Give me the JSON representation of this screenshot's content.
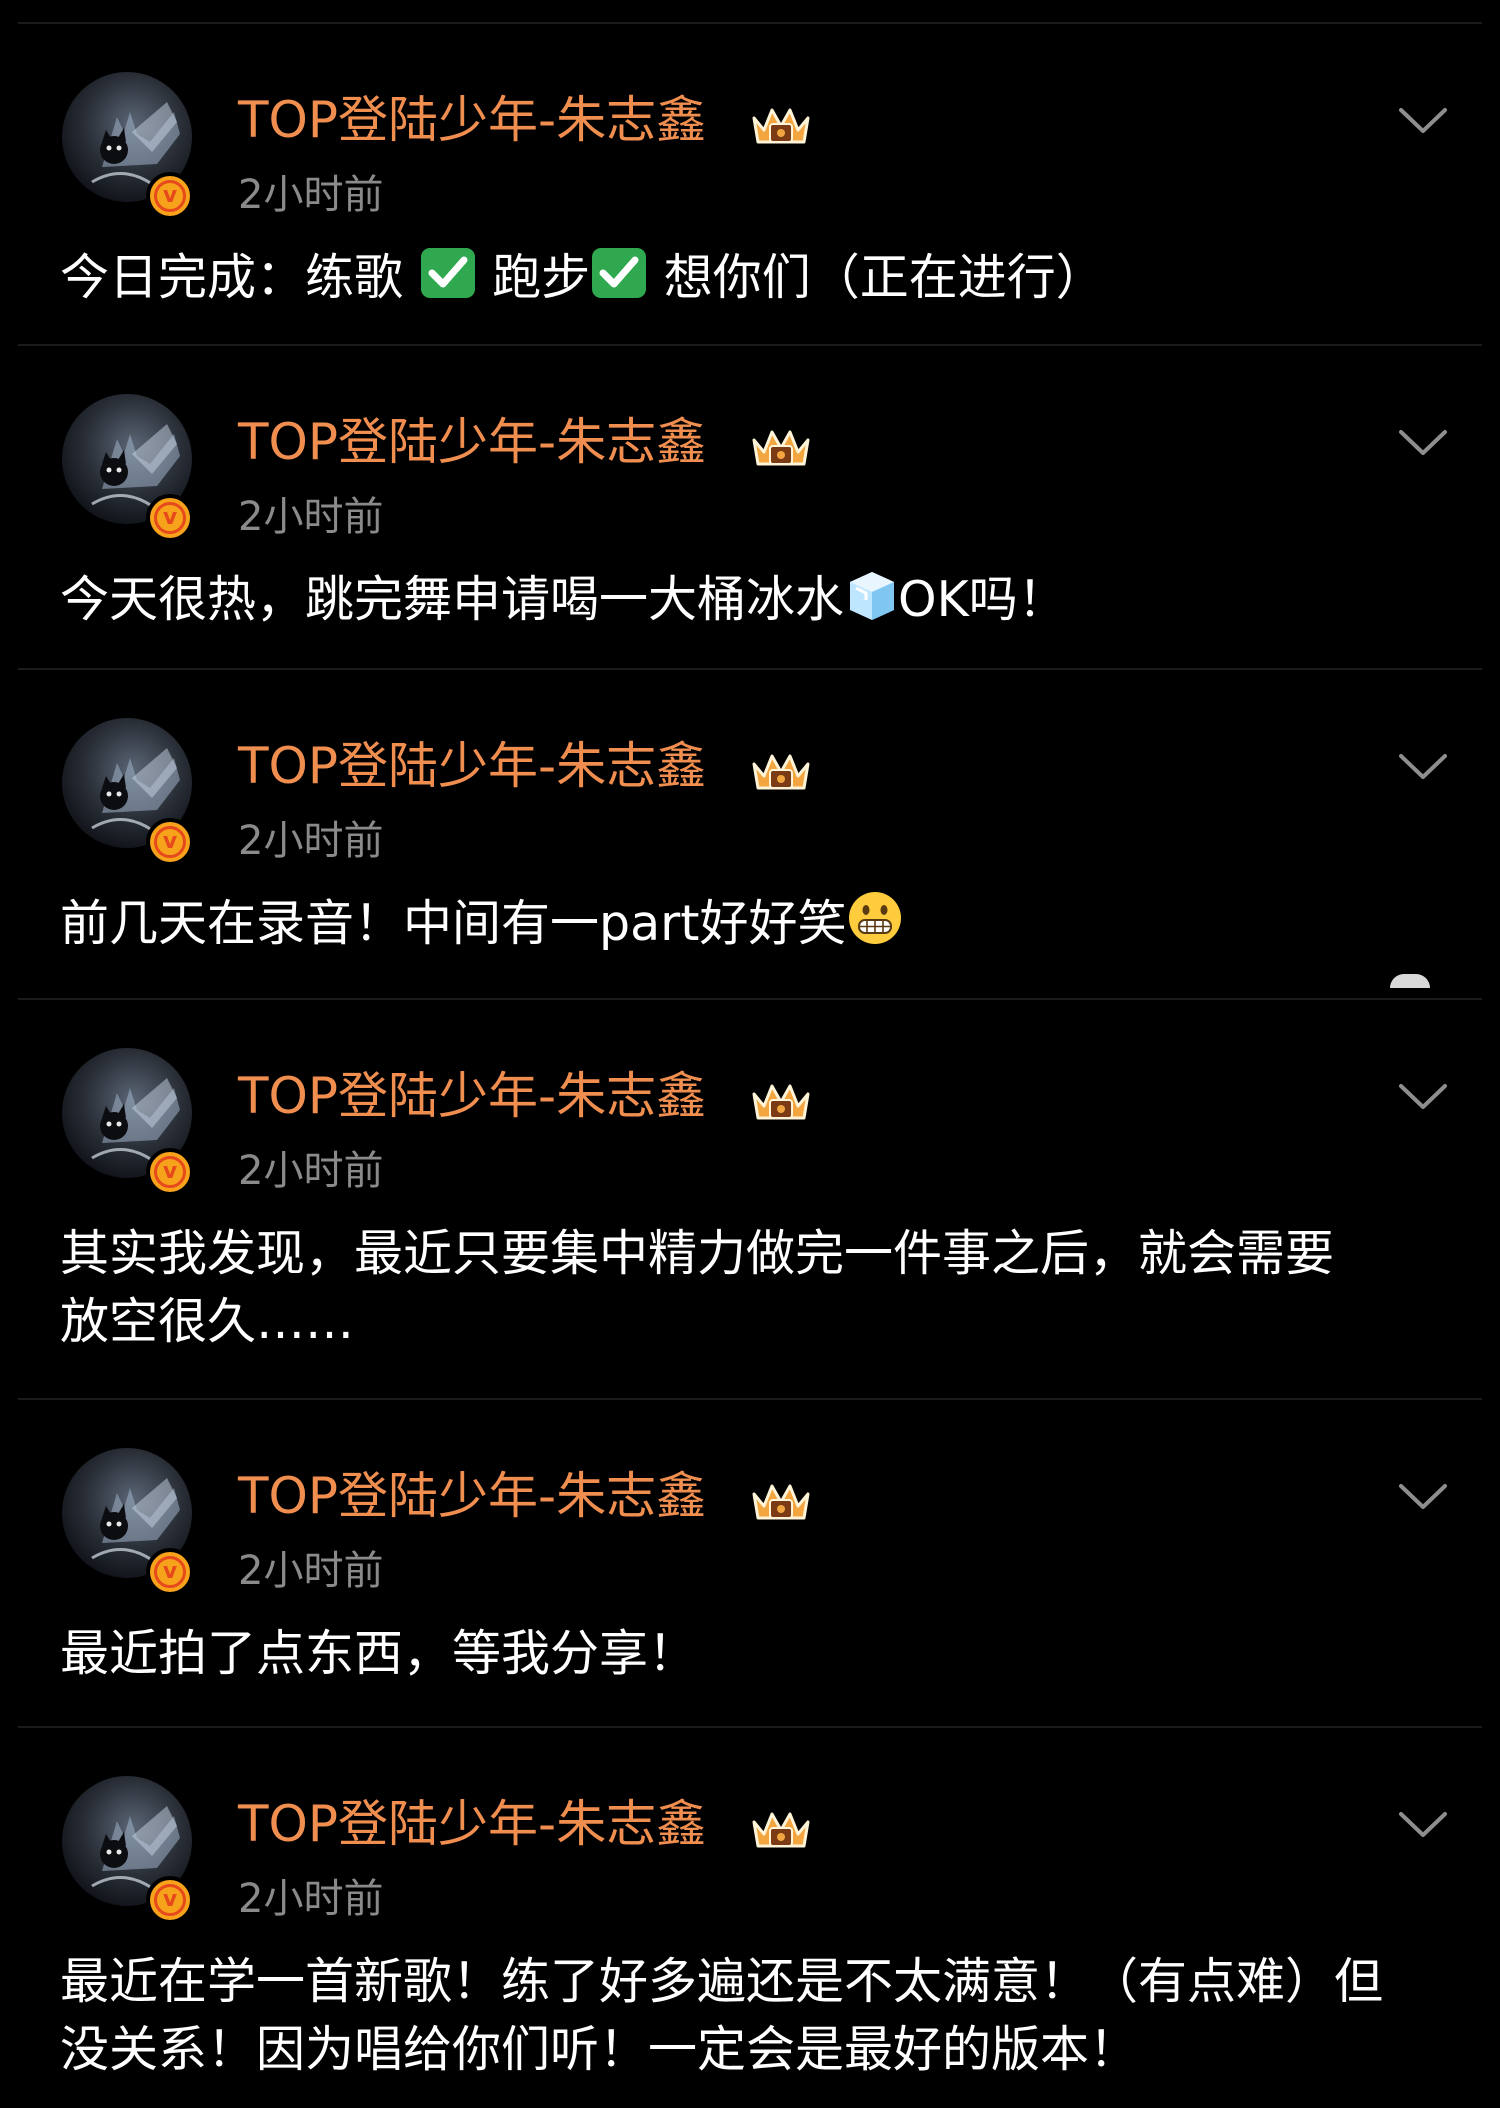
{
  "colors": {
    "background": "#000000",
    "username": "#f08e50",
    "timestamp": "#8a8a8a",
    "text": "#ffffff",
    "verified_badge": "#f7a21b"
  },
  "posts": [
    {
      "username": "TOP登陆少年-朱志鑫",
      "time": "2小时前",
      "segments": [
        "今日完成：练歌 ",
        " 跑步",
        " 想你们（正在进行）"
      ],
      "icons": [
        "crown-icon",
        "verified-icon",
        "chevron-down-icon",
        "check-mark-icon"
      ]
    },
    {
      "username": "TOP登陆少年-朱志鑫",
      "time": "2小时前",
      "segments": [
        "今天很热，跳完舞申请喝一大桶冰水",
        "OK吗！"
      ],
      "icons": [
        "crown-icon",
        "verified-icon",
        "chevron-down-icon",
        "ice-cube-icon"
      ]
    },
    {
      "username": "TOP登陆少年-朱志鑫",
      "time": "2小时前",
      "segments": [
        "前几天在录音！中间有一part好好笑"
      ],
      "icons": [
        "crown-icon",
        "verified-icon",
        "chevron-down-icon",
        "grimacing-face-icon"
      ]
    },
    {
      "username": "TOP登陆少年-朱志鑫",
      "time": "2小时前",
      "segments": [
        "其实我发现，最近只要集中精力做完一件事之后，就会需要\n放空很久……"
      ],
      "icons": [
        "crown-icon",
        "verified-icon",
        "chevron-down-icon"
      ]
    },
    {
      "username": "TOP登陆少年-朱志鑫",
      "time": "2小时前",
      "segments": [
        "最近拍了点东西，等我分享！"
      ],
      "icons": [
        "crown-icon",
        "verified-icon",
        "chevron-down-icon"
      ]
    },
    {
      "username": "TOP登陆少年-朱志鑫",
      "time": "2小时前",
      "segments": [
        "最近在学一首新歌！练了好多遍还是不太满意！（有点难）但\n没关系！因为唱给你们听！一定会是最好的版本！"
      ],
      "icons": [
        "crown-icon",
        "verified-icon",
        "chevron-down-icon"
      ]
    }
  ]
}
